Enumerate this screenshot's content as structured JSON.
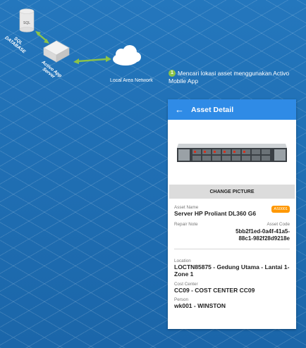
{
  "diagram": {
    "db_label": "SQL\nDATABASE",
    "server_label": "Activo App\nServer",
    "network_label": "Local Area Network",
    "db_icon_text": "SQL"
  },
  "step": {
    "number": "1",
    "text": "Mencari lokasi asset menggunakan Activo Mobile App"
  },
  "app": {
    "title": "Asset Detail",
    "change_picture": "CHANGE PICTURE",
    "asset_name_label": "Asset Name",
    "asset_name": "Server HP Proliant DL360 G6",
    "badge": "AS0001",
    "repair_note_label": "Repair Note",
    "asset_code_label": "Asset Code",
    "asset_code": "5bb2f1ed-0a4f-41a5-88c1-982f28d9218e",
    "location_label": "Location",
    "location": "LOCTN85875 - Gedung Utama - Lantai 1-Zone 1",
    "cost_center_label": "Cost Center",
    "cost_center": "CC09 - COST CENTER CC09",
    "person_label": "Person",
    "person": "wk001 - WINSTON"
  },
  "colors": {
    "appbar": "#2f8be6",
    "badge": "#ff9800",
    "step": "#8bc34a",
    "arrow": "#8bc34a"
  }
}
